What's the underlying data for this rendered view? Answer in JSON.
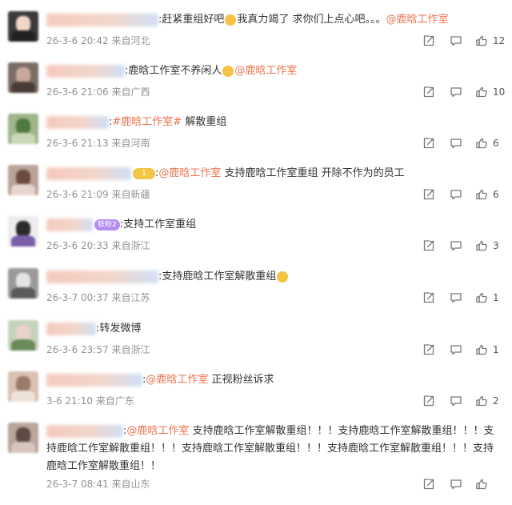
{
  "accent_color": "#eb7350",
  "meta_color": "#939393",
  "comments": [
    {
      "text_pre": ":赶紧重组好吧",
      "emoji": "tear-emoji",
      "text_mid": "我真力竭了 求你们上点心吧。。。",
      "mention": "@鹿晗工作室",
      "text_post": "",
      "badge": "",
      "time": "26-3-6 20:42",
      "location": "来自河北",
      "likes": "12",
      "avatar": [
        "#3a3a3a",
        "#f0d7c8",
        "#222222"
      ],
      "name_width": 140
    },
    {
      "text_pre": ":鹿晗工作室不养闲人",
      "emoji": "sad-emoji",
      "text_mid": "",
      "mention": "@鹿晗工作室",
      "text_post": "",
      "badge": "",
      "time": "26-3-6 21:06",
      "location": "来自广西",
      "likes": "10",
      "avatar": [
        "#7a6d66",
        "#c7a89a",
        "#4b3b36"
      ],
      "name_width": 98
    },
    {
      "text_pre": ":",
      "emoji": "",
      "text_mid": "",
      "mention": "#鹿晗工作室#",
      "text_post": " 解散重组",
      "badge": "",
      "time": "26-3-6 21:13",
      "location": "来自河南",
      "likes": "6",
      "avatar": [
        "#9fb58a",
        "#4f7a3f",
        "#c9d8b6"
      ],
      "name_width": 78
    },
    {
      "text_pre": ":",
      "emoji": "",
      "text_mid": "",
      "mention": "@鹿晗工作室",
      "text_post": " 支持鹿晗工作室重组 开除不作为的员工",
      "badge": "crown",
      "badge_text": "1",
      "time": "26-3-6 21:09",
      "location": "来自新疆",
      "likes": "6",
      "avatar": [
        "#b9a39a",
        "#6d4a3f",
        "#e5d5cd"
      ],
      "name_width": 106
    },
    {
      "text_pre": ":支持工作室重组",
      "emoji": "",
      "text_mid": "",
      "mention": "",
      "text_post": "",
      "badge": "fans",
      "badge_text": "铁粉2",
      "time": "26-3-6 20:33",
      "location": "来自浙江",
      "likes": "3",
      "avatar": [
        "#ededed",
        "#2b2b2b",
        "#7a5ea8"
      ],
      "name_width": 58
    },
    {
      "text_pre": ":支持鹿晗工作室解散重组",
      "emoji": "fire-emoji",
      "text_mid": "",
      "mention": "",
      "text_post": "",
      "badge": "",
      "time": "26-3-7 00:37",
      "location": "来自江苏",
      "likes": "1",
      "avatar": [
        "#9a9a9a",
        "#e3e3e3",
        "#5a5a5a"
      ],
      "name_width": 140
    },
    {
      "text_pre": ":转发微博",
      "emoji": "",
      "text_mid": "",
      "mention": "",
      "text_post": "",
      "badge": "",
      "time": "26-3-6 23:57",
      "location": "来自浙江",
      "likes": "1",
      "avatar": [
        "#c6d3bb",
        "#e7d3c9",
        "#6b8a5a"
      ],
      "name_width": 62
    },
    {
      "text_pre": ":",
      "emoji": "",
      "text_mid": "",
      "mention": "@鹿晗工作室",
      "text_post": " 正视粉丝诉求",
      "badge": "",
      "time": "3-6 21:10",
      "location": "来自广东",
      "likes": "2",
      "avatar": [
        "#d9c1b3",
        "#9b7a69",
        "#efe2da"
      ],
      "name_width": 120
    },
    {
      "text_pre": ":",
      "emoji": "",
      "text_mid": "",
      "mention": "@鹿晗工作室",
      "text_post": " 支持鹿晗工作室解散重组！！！支持鹿晗工作室解散重组！！！支持鹿晗工作室解散重组！！！支持鹿晗工作室解散重组！！！支持鹿晗工作室解散重组！！！支持鹿晗工作室解散重组！！",
      "badge": "",
      "time": "26-3-7 08:41",
      "location": "来自山东",
      "likes": "",
      "avatar": [
        "#b8a59b",
        "#5c4a43",
        "#d6c6be"
      ],
      "name_width": 96
    }
  ]
}
